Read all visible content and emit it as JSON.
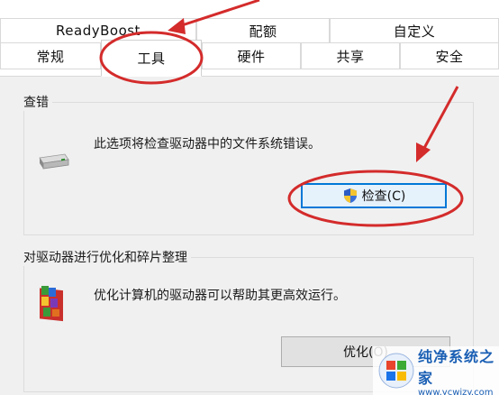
{
  "tabs": {
    "row1": [
      {
        "label": "ReadyBoost"
      },
      {
        "label": "配额"
      },
      {
        "label": "自定义"
      }
    ],
    "row2": [
      {
        "label": "常规"
      },
      {
        "label": "工具",
        "active": true
      },
      {
        "label": "硬件"
      },
      {
        "label": "共享"
      },
      {
        "label": "安全"
      }
    ]
  },
  "check_group": {
    "title": "查错",
    "description": "此选项将检查驱动器中的文件系统错误。",
    "button_label": "检查(C)"
  },
  "optimize_group": {
    "title": "对驱动器进行优化和碎片整理",
    "description": "优化计算机的驱动器可以帮助其更高效运行。",
    "button_label": "优化(O)"
  },
  "watermark": {
    "title": "纯净系统之家",
    "url": "www.ycwjzy.com"
  },
  "colors": {
    "annotation_red": "#d42b2b",
    "focus_blue": "#0078d7",
    "panel_bg": "#f0f0f0"
  }
}
